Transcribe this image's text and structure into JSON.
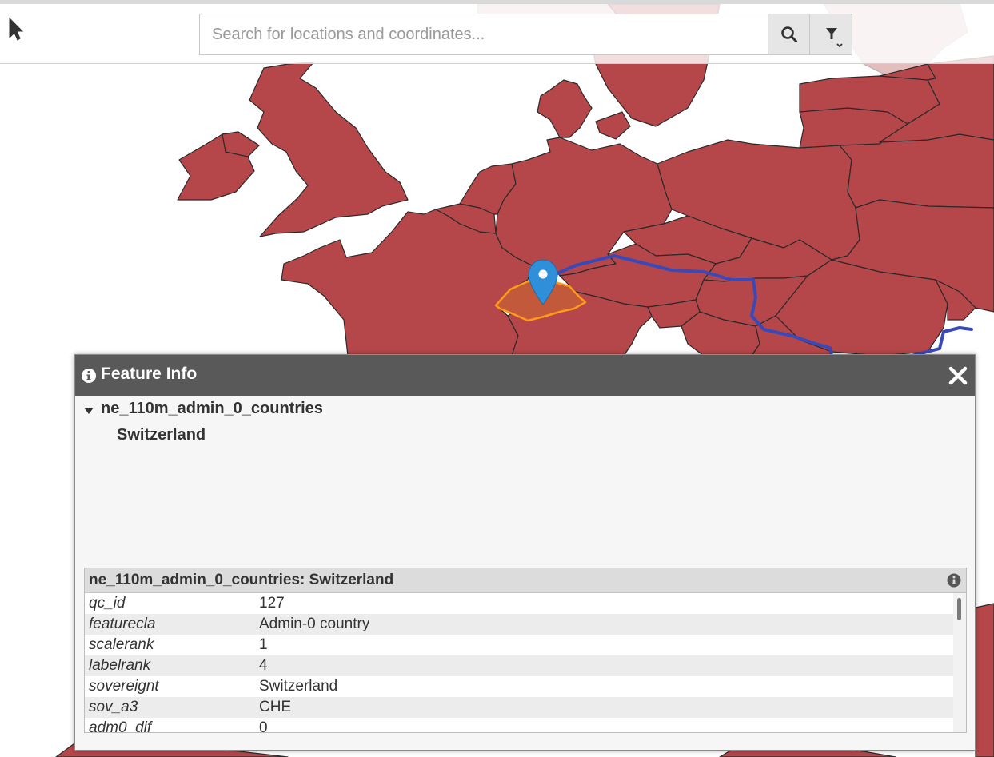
{
  "colors": {
    "land": "#b5474b",
    "border": "#2a2a2a",
    "highlight_fill": "#c2593a",
    "highlight_stroke": "#ff9a1a",
    "river": "#3a49b8",
    "marker": "#2f8fd8",
    "dialog_header": "#595959"
  },
  "toolbar": {
    "search": {
      "placeholder": "Search for locations and coordinates..."
    },
    "icons": {
      "toggle": "pointer-arrow-icon",
      "search": "search-icon",
      "filter": "filter-icon"
    }
  },
  "dialog": {
    "title": "Feature Info",
    "layer_name": "ne_110m_admin_0_countries",
    "feature_name": "Switzerland",
    "attributes": {
      "title": "ne_110m_admin_0_countries: Switzerland",
      "rows": [
        {
          "key": "qc_id",
          "value": "127"
        },
        {
          "key": "featurecla",
          "value": "Admin-0 country"
        },
        {
          "key": "scalerank",
          "value": "1"
        },
        {
          "key": "labelrank",
          "value": "4"
        },
        {
          "key": "sovereignt",
          "value": "Switzerland"
        },
        {
          "key": "sov_a3",
          "value": "CHE"
        },
        {
          "key": "adm0_dif",
          "value": "0"
        }
      ]
    }
  }
}
